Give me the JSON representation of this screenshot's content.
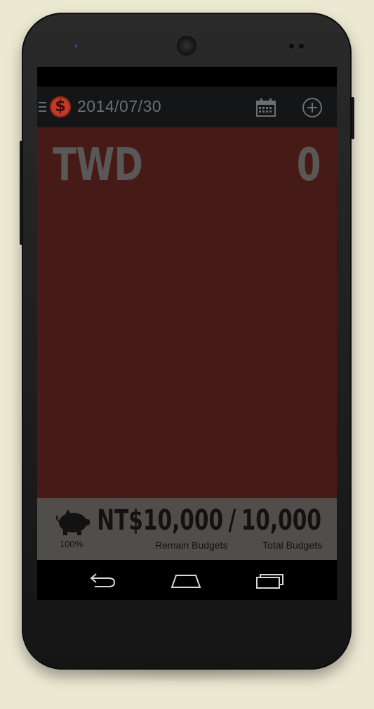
{
  "app_bar": {
    "menu_icon": "hamburger-icon",
    "logo_symbol": "$",
    "logo_color": "#c43a28",
    "date": "2014/07/30",
    "calendar_icon": "calendar-icon",
    "add_icon": "add-circle-icon"
  },
  "main": {
    "currency": "TWD",
    "amount": "0",
    "background_color": "#461a17"
  },
  "budget": {
    "piggy_icon": "piggy-bank-icon",
    "percent": "100%",
    "remain_value": "NT$10,000",
    "separator": "/",
    "total_value": "10,000",
    "remain_label": "Remain Budgets",
    "total_label": "Total Budgets"
  },
  "nav": {
    "back_icon": "back-icon",
    "home_icon": "home-icon",
    "recents_icon": "recents-icon"
  }
}
